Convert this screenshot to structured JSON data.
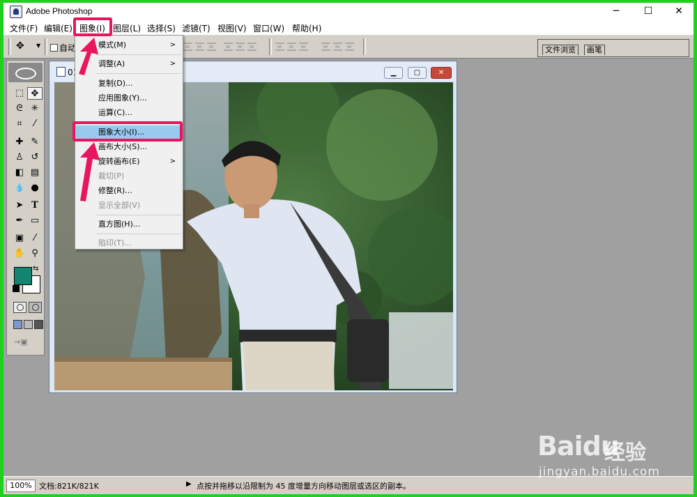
{
  "app": {
    "title": "Adobe Photoshop",
    "minimize": "─",
    "maximize": "☐",
    "close": "✕"
  },
  "menubar": [
    "文件(F)",
    "编辑(E)",
    "图象(I)",
    "图层(L)",
    "选择(S)",
    "滤镜(T)",
    "视图(V)",
    "窗口(W)",
    "帮助(H)"
  ],
  "options": {
    "auto_select_label": "自动"
  },
  "palette_well": {
    "tabs": [
      "文件浏览",
      "画笔"
    ]
  },
  "document": {
    "title": "01"
  },
  "image_menu": {
    "items": [
      {
        "label": "模式(M)",
        "submenu": true,
        "disabled": false,
        "highlight": false
      },
      {
        "label": "调整(A)",
        "submenu": true,
        "disabled": false,
        "highlight": false
      },
      {
        "label": "复制(D)...",
        "submenu": false,
        "disabled": false,
        "highlight": false
      },
      {
        "label": "应用图象(Y)...",
        "submenu": false,
        "disabled": false,
        "highlight": false
      },
      {
        "label": "运算(C)...",
        "submenu": false,
        "disabled": false,
        "highlight": false
      },
      {
        "label": "图象大小(I)...",
        "submenu": false,
        "disabled": false,
        "highlight": true
      },
      {
        "label": "画布大小(S)...",
        "submenu": false,
        "disabled": false,
        "highlight": false
      },
      {
        "label": "旋转画布(E)",
        "submenu": true,
        "disabled": false,
        "highlight": false
      },
      {
        "label": "裁切(P)",
        "submenu": false,
        "disabled": true,
        "highlight": false
      },
      {
        "label": "修整(R)...",
        "submenu": false,
        "disabled": false,
        "highlight": false
      },
      {
        "label": "显示全部(V)",
        "submenu": false,
        "disabled": true,
        "highlight": false
      },
      {
        "label": "直方图(H)...",
        "submenu": false,
        "disabled": false,
        "highlight": false
      },
      {
        "label": "陷印(T)...",
        "submenu": false,
        "disabled": true,
        "highlight": false
      }
    ]
  },
  "toolbox": {
    "tools": [
      {
        "name": "marquee-tool-icon",
        "glyph": "⬚"
      },
      {
        "name": "move-tool-icon",
        "glyph": "✥"
      },
      {
        "name": "lasso-tool-icon",
        "glyph": "ᘓ"
      },
      {
        "name": "magic-wand-tool-icon",
        "glyph": "✳"
      },
      {
        "name": "crop-tool-icon",
        "glyph": "⌗"
      },
      {
        "name": "slice-tool-icon",
        "glyph": "⁄"
      },
      {
        "name": "healing-brush-tool-icon",
        "glyph": "✚"
      },
      {
        "name": "brush-tool-icon",
        "glyph": "✎"
      },
      {
        "name": "clone-stamp-tool-icon",
        "glyph": "♙"
      },
      {
        "name": "history-brush-tool-icon",
        "glyph": "↺"
      },
      {
        "name": "eraser-tool-icon",
        "glyph": "◧"
      },
      {
        "name": "gradient-tool-icon",
        "glyph": "▤"
      },
      {
        "name": "blur-tool-icon",
        "glyph": "💧"
      },
      {
        "name": "dodge-tool-icon",
        "glyph": "●"
      },
      {
        "name": "path-selection-tool-icon",
        "glyph": "➤"
      },
      {
        "name": "type-tool-icon",
        "glyph": "T"
      },
      {
        "name": "pen-tool-icon",
        "glyph": "✒"
      },
      {
        "name": "shape-tool-icon",
        "glyph": "▭"
      },
      {
        "name": "notes-tool-icon",
        "glyph": "▣"
      },
      {
        "name": "eyedropper-tool-icon",
        "glyph": "⁄"
      },
      {
        "name": "hand-tool-icon",
        "glyph": "✋"
      },
      {
        "name": "zoom-tool-icon",
        "glyph": "⚲"
      }
    ],
    "foreground_color": "#138570",
    "background_color": "#ffffff"
  },
  "status": {
    "zoom": "100%",
    "doc_size": "文档:821K/821K",
    "hint": "点按并拖移以沿限制为 45 度增量方向移动图层或选区的副本。"
  },
  "annotations": {
    "color": "#e8155f"
  },
  "watermark": {
    "brand": "Baidu",
    "brand2": "经验",
    "url": "jingyan.baidu.com"
  }
}
